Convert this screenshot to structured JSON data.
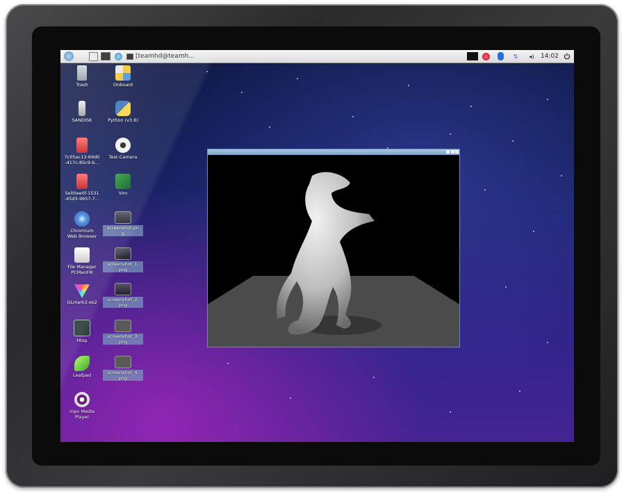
{
  "taskbar": {
    "window_title": "[teamhd@teamh...",
    "volume": "◂)",
    "clock": "14:02",
    "arrows": "⇅"
  },
  "desktop": {
    "icons": [
      {
        "label": "Trash"
      },
      {
        "label": "Onboard"
      },
      {
        "label": "SANDISK"
      },
      {
        "label": "Python (v3.6)"
      },
      {
        "label": "7c05ac13-69d0\n-417c-85c9-b..."
      },
      {
        "label": "Test-Camera"
      },
      {
        "label": "5e00ee0f-1531\n-45d3-9657-7..."
      },
      {
        "label": "Vim"
      },
      {
        "label": "Chromium\nWeb Browser"
      },
      {
        "label": "screenshot.pn\ng"
      },
      {
        "label": "File Manager\nPCManFM"
      },
      {
        "label": "screenshot_1.\npng"
      },
      {
        "label": "GLmark2-es2"
      },
      {
        "label": "screenshot_2.\npng"
      },
      {
        "label": "Htop"
      },
      {
        "label": "screenshot_3.\npng"
      },
      {
        "label": "Leafpad"
      },
      {
        "label": "screenshot_4.\npng"
      },
      {
        "label": "mpv Media\nPlayer"
      }
    ]
  },
  "colors": {
    "bezel": "#3a3a3c",
    "taskbar": "#e6e6e6",
    "window_title": "#8fb1d6",
    "floor": "#4b4b4b"
  }
}
